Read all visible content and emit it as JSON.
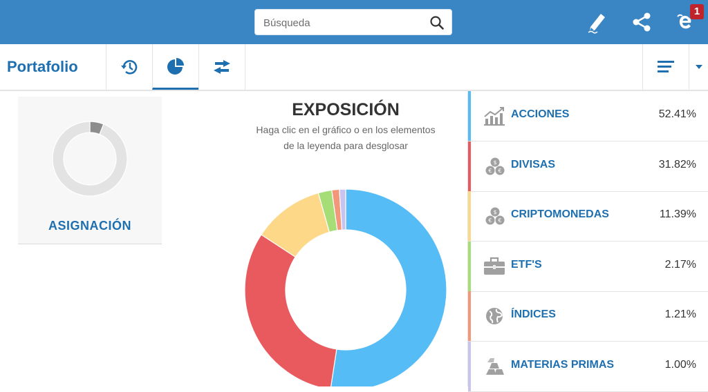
{
  "search": {
    "placeholder": "Búsqueda"
  },
  "notifications": {
    "badge_count": "1"
  },
  "toolbar": {
    "title": "Portafolio"
  },
  "allocation_card": {
    "label": "ASIGNACIÓN"
  },
  "exposure": {
    "title": "EXPOSICIÓN",
    "subtitle_line1": "Haga clic en el gráfico o en los elementos",
    "subtitle_line2": "de la leyenda para desglosar"
  },
  "legend": [
    {
      "name": "ACCIONES",
      "value": "52.41%",
      "color": "#55bcf5",
      "icon": "chart-growth-icon"
    },
    {
      "name": "DIVISAS",
      "value": "31.82%",
      "color": "#e85a5e",
      "icon": "coins-icon"
    },
    {
      "name": "CRIPTOMONEDAS",
      "value": "11.39%",
      "color": "#fdd889",
      "icon": "coins-icon"
    },
    {
      "name": "ETF'S",
      "value": "2.17%",
      "color": "#a6dd77",
      "icon": "briefcase-icon"
    },
    {
      "name": "ÍNDICES",
      "value": "1.21%",
      "color": "#f3977b",
      "icon": "globe-icon"
    },
    {
      "name": "MATERIAS PRIMAS",
      "value": "1.00%",
      "color": "#c9c3f0",
      "icon": "gold-bars-icon"
    }
  ],
  "chart_data": {
    "type": "pie",
    "categories": [
      "ACCIONES",
      "DIVISAS",
      "CRIPTOMONEDAS",
      "ETF'S",
      "ÍNDICES",
      "MATERIAS PRIMAS"
    ],
    "values": [
      52.41,
      31.82,
      11.39,
      2.17,
      1.21,
      1.0
    ],
    "colors": [
      "#55bcf5",
      "#e85a5e",
      "#fdd889",
      "#a6dd77",
      "#f3977b",
      "#c9c3f0"
    ],
    "title": "EXPOSICIÓN"
  },
  "allocation_chart": {
    "type": "pie",
    "values": [
      94,
      6
    ],
    "colors": [
      "#e3e3e3",
      "#8d8d8d"
    ]
  }
}
